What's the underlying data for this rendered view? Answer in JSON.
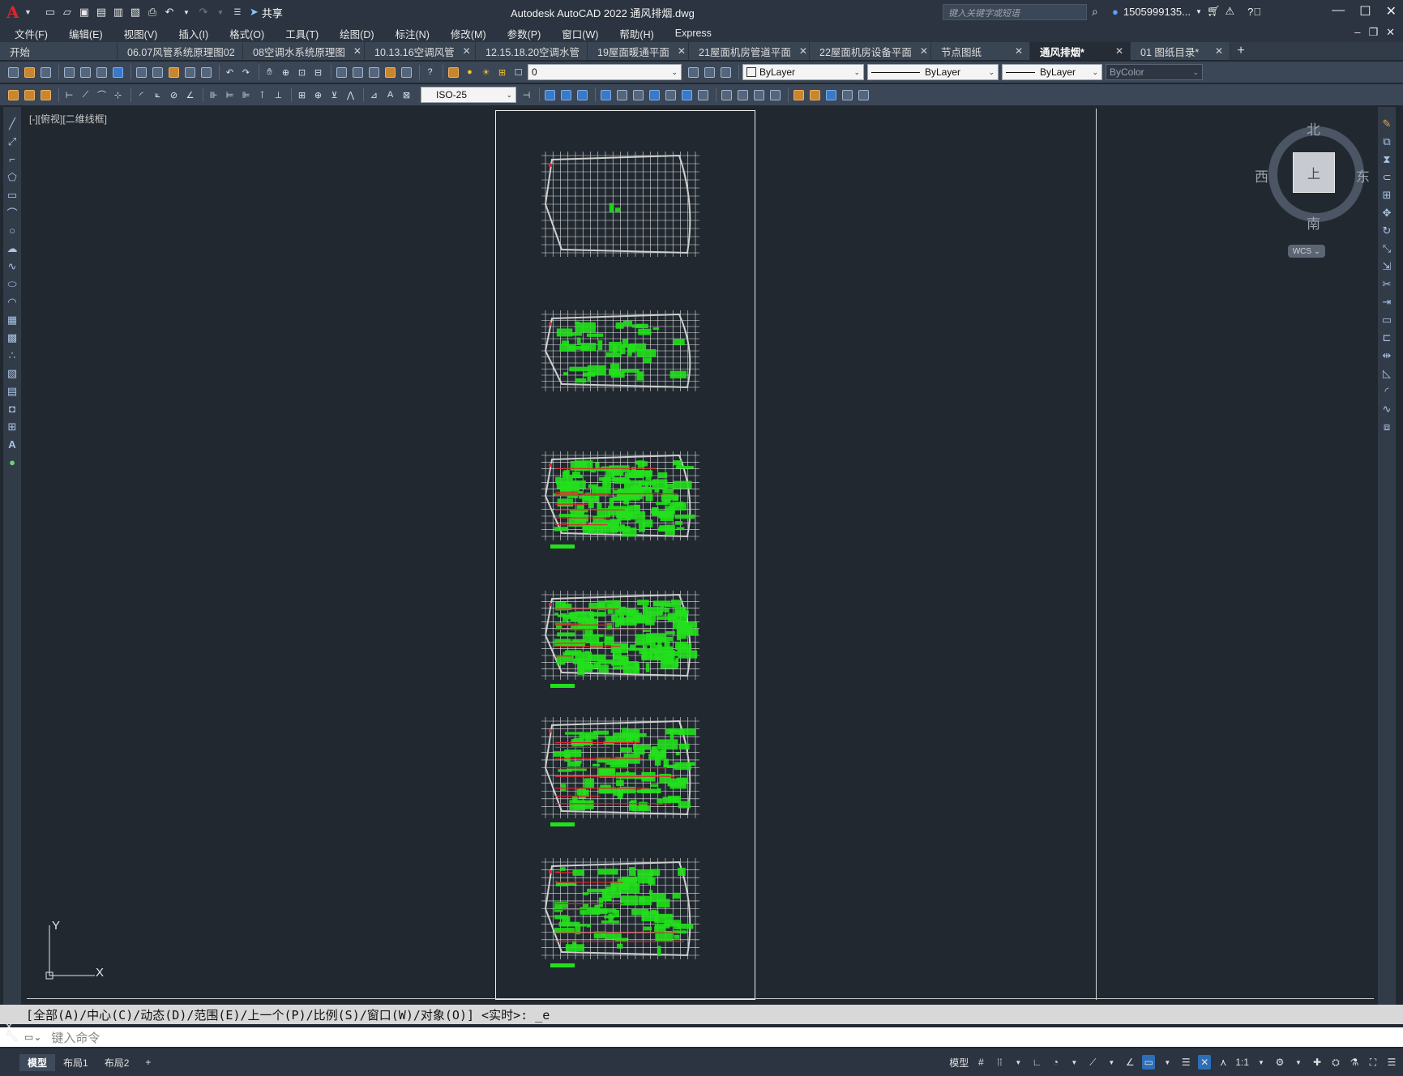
{
  "app": {
    "title": "Autodesk AutoCAD 2022    通风排烟.dwg",
    "share_label": "共享",
    "search_placeholder": "键入关键字或短语",
    "user_name": "1505999135...",
    "logo_letter": "A"
  },
  "menu": [
    "文件(F)",
    "编辑(E)",
    "视图(V)",
    "插入(I)",
    "格式(O)",
    "工具(T)",
    "绘图(D)",
    "标注(N)",
    "修改(M)",
    "参数(P)",
    "窗口(W)",
    "帮助(H)",
    "Express"
  ],
  "tabs": [
    {
      "label": "开始",
      "closable": false,
      "active": false
    },
    {
      "label": "06.07风管系统原理图02",
      "closable": true,
      "active": false
    },
    {
      "label": "08空调水系统原理图",
      "closable": true,
      "active": false
    },
    {
      "label": "10.13.16空调风管",
      "closable": true,
      "active": false
    },
    {
      "label": "12.15.18.20空调水管",
      "closable": true,
      "active": false
    },
    {
      "label": "19屋面暖通平面",
      "closable": true,
      "active": false
    },
    {
      "label": "21屋面机房管道平面",
      "closable": true,
      "active": false
    },
    {
      "label": "22屋面机房设备平面",
      "closable": true,
      "active": false
    },
    {
      "label": "节点图纸",
      "closable": true,
      "active": false
    },
    {
      "label": "通风排烟*",
      "closable": true,
      "active": true
    },
    {
      "label": "01 图纸目录*",
      "closable": true,
      "active": false
    }
  ],
  "toolbar": {
    "layer_value": "0",
    "color_value": "ByLayer",
    "linetype_value": "ByLayer",
    "lineweight_value": "ByLayer",
    "plotstyle_value": "ByColor",
    "dimstyle_value": "ISO-25"
  },
  "viewport": {
    "label": "[-][俯视][二维线框]",
    "ucs_y": "Y",
    "ucs_x": "X"
  },
  "viewcube": {
    "north": "北",
    "south": "南",
    "east": "东",
    "west": "西",
    "face": "上",
    "wcs": "WCS"
  },
  "command": {
    "history": "[全部(A)/中心(C)/动态(D)/范围(E)/上一个(P)/比例(S)/窗口(W)/对象(O)] <实时>: _e",
    "placeholder": "键入命令"
  },
  "layout_tabs": [
    {
      "label": "模型",
      "active": true
    },
    {
      "label": "布局1",
      "active": false
    },
    {
      "label": "布局2",
      "active": false
    }
  ],
  "status": {
    "model_label": "模型",
    "scale": "1:1"
  },
  "colors": {
    "background": "#212830",
    "plan_green": "#22e01c",
    "plan_red": "#e0242b",
    "plan_grid": "#e6e6e6"
  }
}
